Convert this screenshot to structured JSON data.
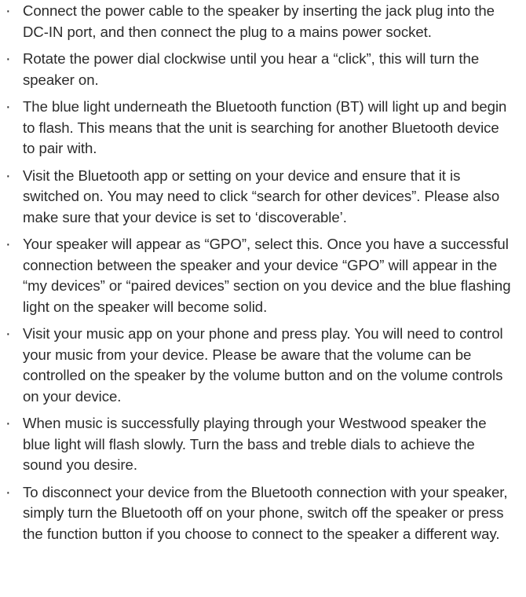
{
  "instructions": {
    "items": [
      "Connect the power cable to the speaker by inserting the jack plug into the DC-IN port, and then connect the plug to a mains power socket.",
      "Rotate the power dial clockwise until you hear a “click”, this will turn the speaker on.",
      "The blue light underneath the Bluetooth function (BT) will light up and begin to flash. This means that the unit is searching for another Bluetooth device to pair with.",
      "Visit the Bluetooth app or setting on your device and ensure that it is switched on. You may need to click “search for other devices”. Please also make sure that your device is set to ‘discoverable’.",
      "Your speaker will appear as “GPO”, select this. Once you have a successful connection between the speaker and your device “GPO” will appear in the “my devices” or “paired devices” section on you device and the blue flashing light on the speaker will become solid.",
      "Visit your music app on your phone and press play. You will need to control your music from your device. Please be aware that the volume can be controlled on the speaker by the volume button and on the volume controls on your device.",
      "When music is successfully playing through your Westwood speaker the blue light will flash slowly. Turn the bass and treble dials to achieve the sound you desire.",
      "To disconnect your device from the Bluetooth connection with your speaker, simply turn the Bluetooth off on your phone, switch off the speaker or press the function button if you choose to connect to the speaker a different way."
    ],
    "bullet_glyph": "·"
  }
}
